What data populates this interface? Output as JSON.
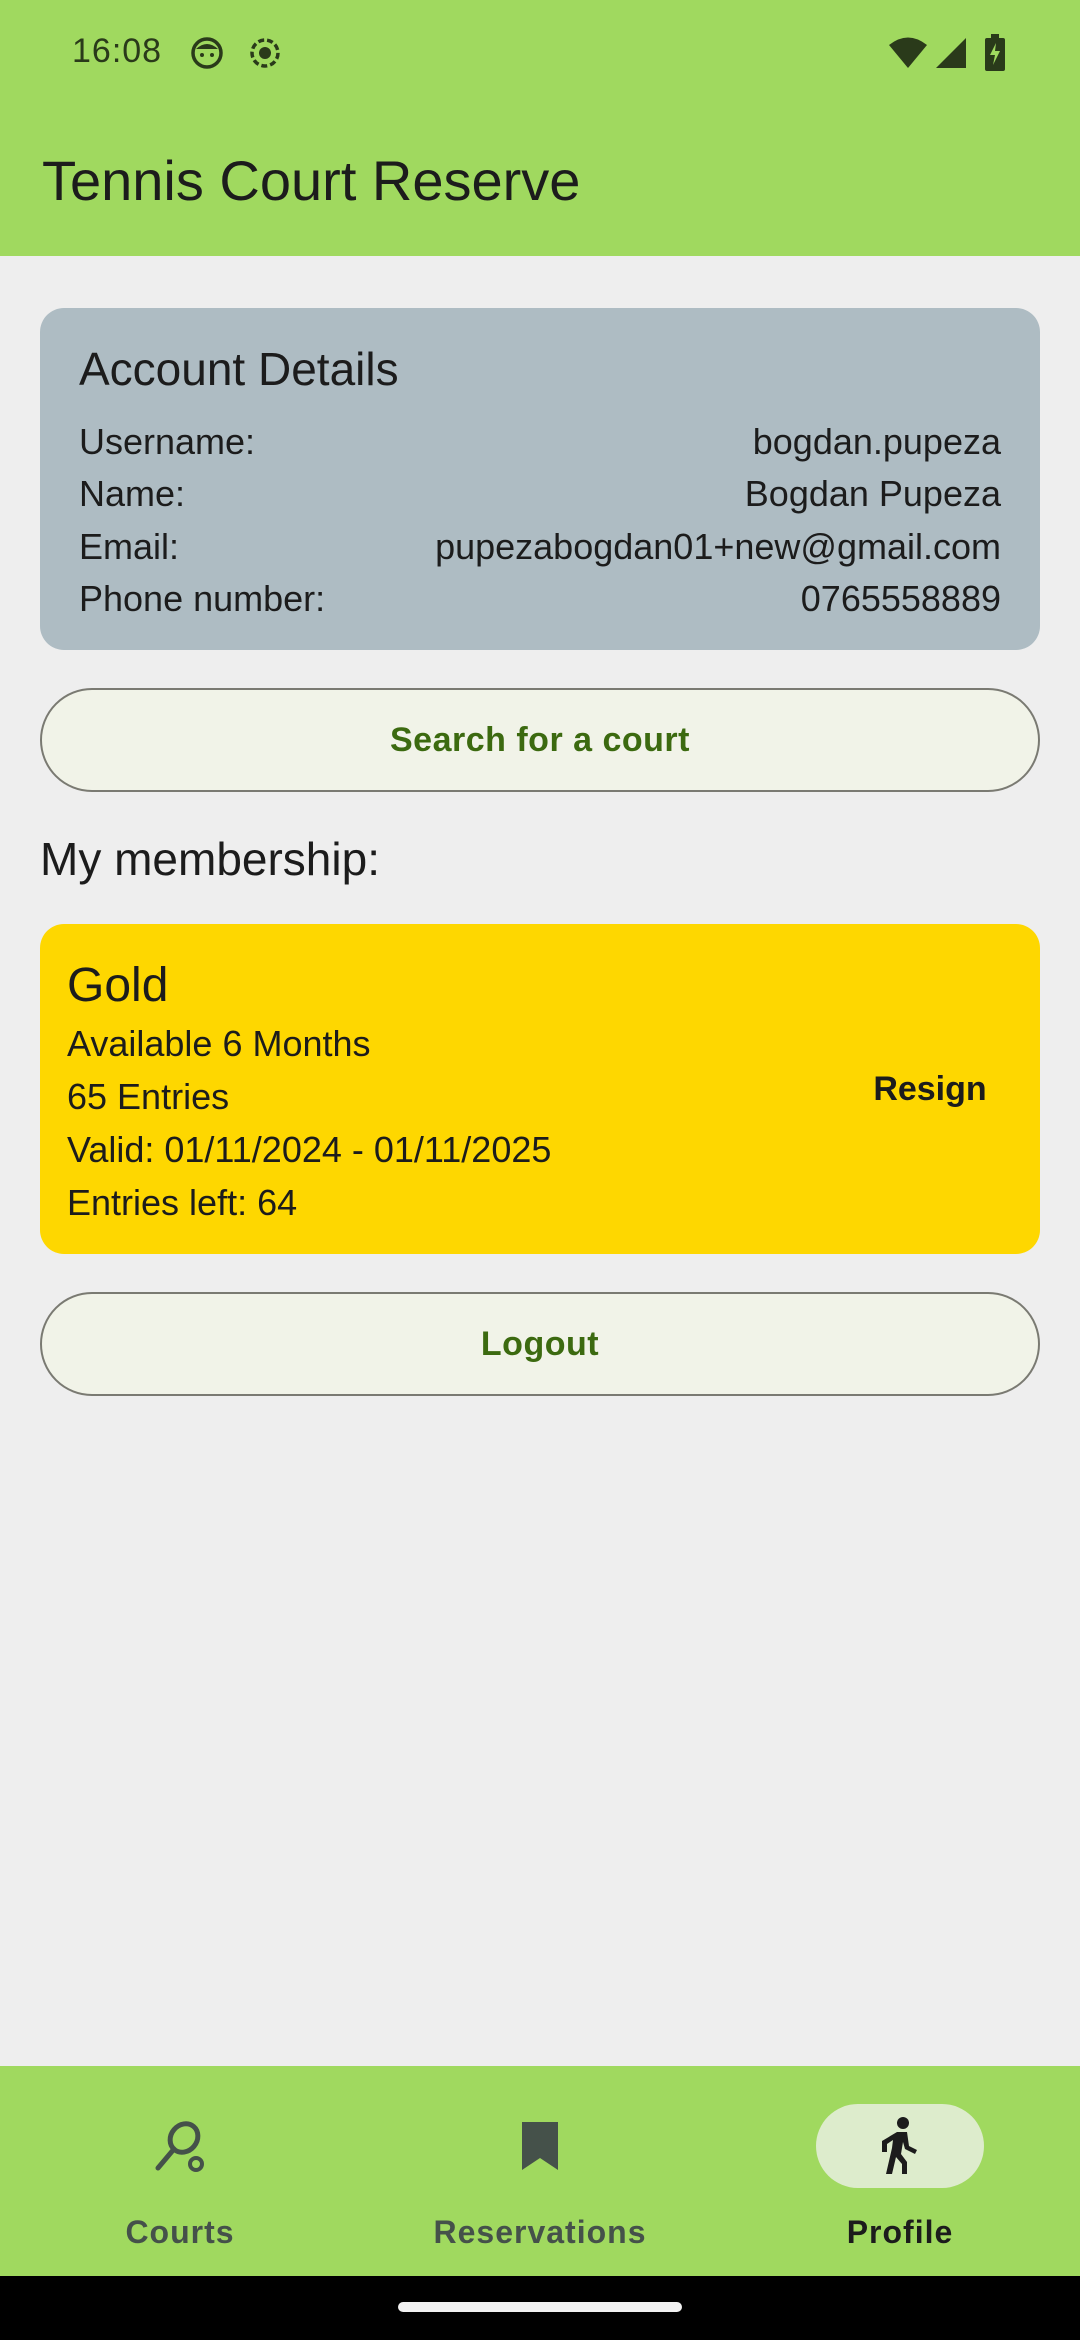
{
  "status_bar": {
    "time": "16:08",
    "icons": [
      "face-icon",
      "record-icon",
      "wifi-icon",
      "signal-icon",
      "battery-icon"
    ]
  },
  "app_bar": {
    "title": "Tennis Court Reserve"
  },
  "account": {
    "title": "Account Details",
    "rows": [
      {
        "label": "Username:",
        "value": "bogdan.pupeza"
      },
      {
        "label": "Name:",
        "value": "Bogdan Pupeza"
      },
      {
        "label": "Email:",
        "value": "pupezabogdan01+new@gmail.com"
      },
      {
        "label": "Phone number:",
        "value": "0765558889"
      }
    ]
  },
  "search_button": {
    "label": "Search for a court"
  },
  "membership": {
    "section_title": "My membership:",
    "name": "Gold",
    "availability": "Available 6 Months",
    "entries": "65 Entries",
    "valid": "Valid: 01/11/2024 - 01/11/2025",
    "entries_left": "Entries left: 64",
    "resign_label": "Resign"
  },
  "logout_button": {
    "label": "Logout"
  },
  "nav": {
    "items": [
      {
        "label": "Courts",
        "icon": "racket-icon",
        "active": false
      },
      {
        "label": "Reservations",
        "icon": "bookmark-icon",
        "active": false
      },
      {
        "label": "Profile",
        "icon": "walking-person-icon",
        "active": true
      }
    ]
  },
  "colors": {
    "brand_green": "#a0d95f",
    "membership_gold": "#fed700",
    "account_card": "#aebcc3",
    "button_text": "#3c6a10"
  }
}
